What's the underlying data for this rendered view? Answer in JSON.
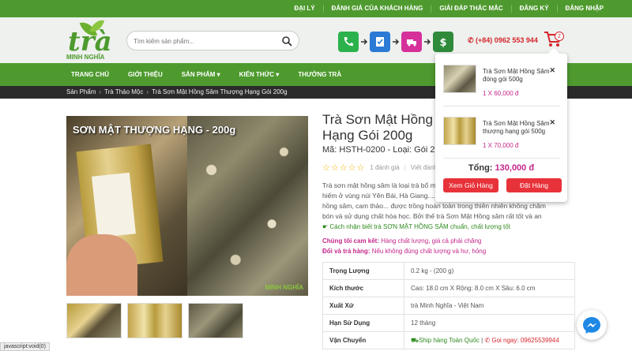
{
  "topbar": {
    "links": [
      "ĐẠI LÝ",
      "ĐÁNH GIÁ CỦA KHÁCH HÀNG",
      "GIẢI ĐÁP THẮC MẮC",
      "ĐĂNG KÝ",
      "ĐĂNG NHẬP"
    ]
  },
  "header": {
    "logo_main": "trà",
    "logo_brand": "MINH NGHĨA",
    "search_placeholder": "Tìm kiếm sản phẩm...",
    "hotline": "(+84) 0962 553 944",
    "cart_count": "2"
  },
  "nav": {
    "items": [
      "TRANG CHỦ",
      "GIỚI THIỆU",
      "SẢN PHẨM",
      "KIẾN THỨC",
      "THƯỞNG TRÀ"
    ]
  },
  "breadcrumb": {
    "items": [
      "Sản Phẩm",
      "Trà Thảo Mộc",
      "Trà Sơn Mật Hồng Sâm Thượng Hạng Gói 200g"
    ]
  },
  "gallery": {
    "main_caption": "SƠN MẬT THƯỢNG HẠNG - 200g",
    "watermark": "MINH NGHĨA"
  },
  "product": {
    "title": "Trà Sơn Mật Hồng Sâm Thượng Hạng Gói 200g",
    "meta": "Mã: HSTH-0200 - Loại: Gói 200g",
    "stars": "☆☆☆☆☆",
    "rating_count": "1 đánh giá",
    "write_review": "Viết đánh giá",
    "description": "Trà sơn mật hồng sâm là loại trà bổ mát được làm từ các loại thảo mộc quý hiếm ở vùng núi Yên Bái, Hà Giang.... Với các thành phần như lá sơn mật, hồng sâm, cam thảo... được trồng hoàn toàn trong thiên nhiên không chăm bón và sử dụng chất hóa học. Bởi thế trà Sơn Mật Hồng sâm rất tốt và an toàn cho người sử dụng.",
    "guide": "☛ Cách nhận biết trà SƠN MẬT HỒNG SÂM chuẩn, chất lượng tốt",
    "commit_label": "Chúng tôi cam kết:",
    "commit_text": " Hàng chất lượng, giá cả phải chăng",
    "returns_label": "Đổi và trả hàng:",
    "returns_text": " Nếu không đúng chất lượng và hư, hỏng"
  },
  "specs": [
    {
      "k": "Trọng Lượng",
      "v": "0.2 kg - (200 g)"
    },
    {
      "k": "Kích thước",
      "v": "Cao: 18.0 cm X Rộng: 8.0 cm X Sâu: 6.0 cm"
    },
    {
      "k": "Xuất Xứ",
      "v": "trà Minh Nghĩa - Việt Nam"
    },
    {
      "k": "Hạn Sử Dụng",
      "v": "12 tháng"
    },
    {
      "k": "Vận Chuyển",
      "ship": "Ship hàng Toàn Quốc",
      "sep": " | ",
      "call": "Gọi ngay: 09625539944"
    }
  ],
  "cart": {
    "items": [
      {
        "name": "Trà Sơn Mật Hồng Sâm đóng gói 500g",
        "price": "1 X 60,000 đ"
      },
      {
        "name": "Trà Sơn Mật Hồng Sâm thượng hạng gói 500g",
        "price": "1 X 70,000 đ"
      }
    ],
    "total_label": "Tổng: ",
    "total_value": "130,000 đ",
    "view_cart": "Xem Giỏ Hàng",
    "checkout": "Đặt Hàng"
  },
  "status": "javascript:void(0)",
  "colors": {
    "brand_green": "#4e9a2e",
    "accent_red": "#e8323a",
    "price_pink": "#c4268a"
  }
}
